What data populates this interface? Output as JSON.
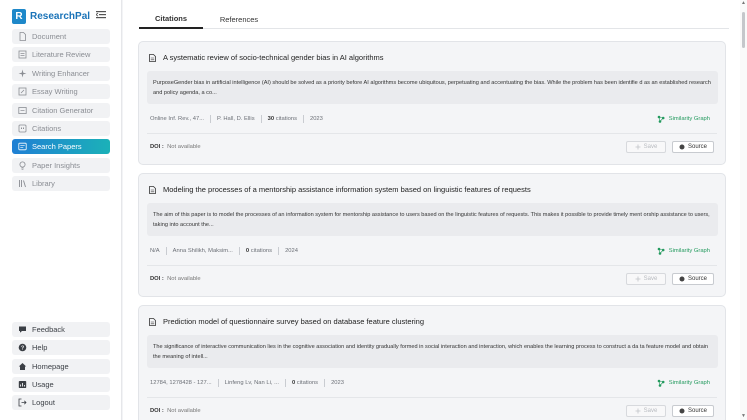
{
  "brand": {
    "name": "ResearchPal",
    "logo_letter": "R"
  },
  "sidebar": {
    "items": [
      {
        "label": "Document",
        "icon": "file-icon",
        "active": false
      },
      {
        "label": "Literature Review",
        "icon": "list-icon",
        "active": false
      },
      {
        "label": "Writing Enhancer",
        "icon": "sparkle-icon",
        "active": false
      },
      {
        "label": "Essay Writing",
        "icon": "edit-icon",
        "active": false
      },
      {
        "label": "Citation Generator",
        "icon": "citation-icon",
        "active": false
      },
      {
        "label": "Citations",
        "icon": "quote-icon",
        "active": false
      },
      {
        "label": "Search Papers",
        "icon": "search-icon",
        "active": true
      },
      {
        "label": "Paper Insights",
        "icon": "lightbulb-icon",
        "active": false
      },
      {
        "label": "Library",
        "icon": "library-icon",
        "active": false
      }
    ],
    "bottom_items": [
      {
        "label": "Feedback",
        "icon": "feedback-icon"
      },
      {
        "label": "Help",
        "icon": "help-icon"
      },
      {
        "label": "Homepage",
        "icon": "home-icon"
      },
      {
        "label": "Usage",
        "icon": "usage-icon"
      },
      {
        "label": "Logout",
        "icon": "logout-icon"
      }
    ]
  },
  "tabs": [
    {
      "label": "Citations",
      "active": true
    },
    {
      "label": "References",
      "active": false
    }
  ],
  "papers": [
    {
      "title": "A systematic review of socio-technical gender bias in AI algorithms",
      "abstract": "PurposeGender bias in artificial intelligence (AI) should be solved as a priority before AI algorithms become ubiquitous, perpetuating and accentuating the bias. While the problem has been identifie d as an established research and policy agenda, a co...",
      "venue": "Online Inf. Rev., 47...",
      "authors": "P. Hall, D. Ellis",
      "citations_count": "30",
      "citations_word": "citations",
      "year": "2023",
      "doi_label": "DOI :",
      "doi_value": "Not available"
    },
    {
      "title": "Modeling the processes of a mentorship assistance information system based on linguistic features of requests",
      "abstract": "The aim of this paper is to model the processes of an information system for mentorship assistance to users based on the linguistic features of requests. This makes it possible to provide timely ment orship assistance to users, taking into account the...",
      "venue": "N/A",
      "authors": "Anna Shilikh, Maksim...",
      "citations_count": "0",
      "citations_word": "citations",
      "year": "2024",
      "doi_label": "DOI :",
      "doi_value": "Not available"
    },
    {
      "title": "Prediction model of questionnaire survey based on database feature clustering",
      "abstract": "The significance of interactive communication lies in the cognitive association and identity gradually formed in social interaction and interaction, which enables the learning process to construct a da ta feature model and obtain the meaning of intell...",
      "venue": "12784, 1278428 - 127...",
      "authors": "Linfeng Lv, Nan Li, ...",
      "citations_count": "0",
      "citations_word": "citations",
      "year": "2023",
      "doi_label": "DOI :",
      "doi_value": "Not available"
    }
  ],
  "card_actions": {
    "similarity_graph": "Similarity Graph",
    "save": "Save",
    "source": "Source"
  },
  "colors": {
    "brand": "#1a73b8",
    "active_gradient_start": "#1f7fd4",
    "active_gradient_end": "#1bb1b8",
    "similarity_green": "#239a5e"
  }
}
